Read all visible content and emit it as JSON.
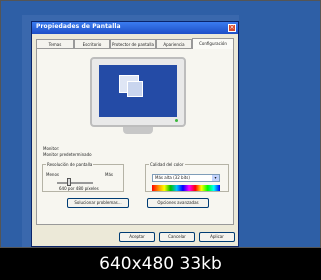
{
  "dialog": {
    "title": "Propiedades de Pantalla",
    "tabs": [
      {
        "label": "Temas"
      },
      {
        "label": "Escritorio"
      },
      {
        "label": "Protector de pantalla"
      },
      {
        "label": "Apariencia"
      },
      {
        "label": "Configuración"
      }
    ],
    "active_tab": "Configuración",
    "monitor_label": "Monitor:",
    "monitor_value": "Monitor predeterminado",
    "resolution_group": {
      "title": "Resolución de pantalla",
      "min_label": "Menos",
      "max_label": "Más",
      "value": "640 por 480 píxeles"
    },
    "color_group": {
      "title": "Calidad del color",
      "selected": "Más alta (32 bits)"
    },
    "troubleshoot_button": "Solucionar problemas...",
    "advanced_button": "Opciones avanzadas",
    "ok_button": "Aceptar",
    "cancel_button": "Cancelar",
    "apply_button": "Aplicar"
  },
  "caption": "640x480 33kb",
  "colors": {
    "desktop": "#2e5fa6",
    "titlebar": "#1e4fc7",
    "dialog_bg": "#ece9d8"
  }
}
